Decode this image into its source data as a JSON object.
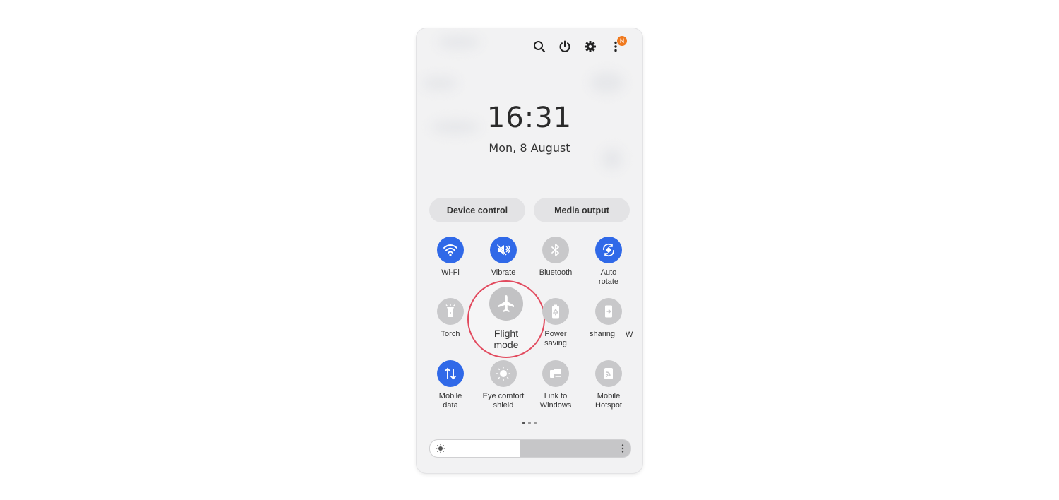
{
  "top_bar": {
    "icons": [
      "search-icon",
      "power-icon",
      "gear-icon",
      "more-vertical-icon"
    ],
    "notification_badge": "N"
  },
  "clock": {
    "time": "16:31",
    "date": "Mon, 8 August"
  },
  "buttons": {
    "device_control": "Device control",
    "media_output": "Media output"
  },
  "tiles": [
    {
      "label": "Wi-Fi",
      "icon": "wifi-icon",
      "state": "on"
    },
    {
      "label": "Vibrate",
      "icon": "vibrate-icon",
      "state": "on"
    },
    {
      "label": "Bluetooth",
      "icon": "bluetooth-icon",
      "state": "off"
    },
    {
      "label": "Auto\nrotate",
      "icon": "auto-rotate-icon",
      "state": "on"
    },
    {
      "label": "Torch",
      "icon": "torch-icon",
      "state": "off"
    },
    {
      "label": "Flight\nmode",
      "icon": "airplane-icon",
      "state": "off",
      "highlighted": true
    },
    {
      "label": "Power\nsaving",
      "icon": "battery-icon",
      "state": "off"
    },
    {
      "label": "sharing",
      "icon": "share-icon",
      "state": "off"
    },
    {
      "label": "Mobile\ndata",
      "icon": "mobile-data-icon",
      "state": "on"
    },
    {
      "label": "Eye comfort\nshield",
      "icon": "eye-comfort-icon",
      "state": "off"
    },
    {
      "label": "Link to\nWindows",
      "icon": "link-windows-icon",
      "state": "off"
    },
    {
      "label": "Mobile\nHotspot",
      "icon": "hotspot-icon",
      "state": "off"
    }
  ],
  "edge_label": "W",
  "pager": {
    "pages": 3,
    "active": 1
  },
  "brightness": {
    "level": 0.45
  },
  "colors": {
    "accent": "#3069e8",
    "inactive": "#c8c8ca",
    "highlight_ring": "#e24a5e",
    "badge": "#f07a1f"
  }
}
